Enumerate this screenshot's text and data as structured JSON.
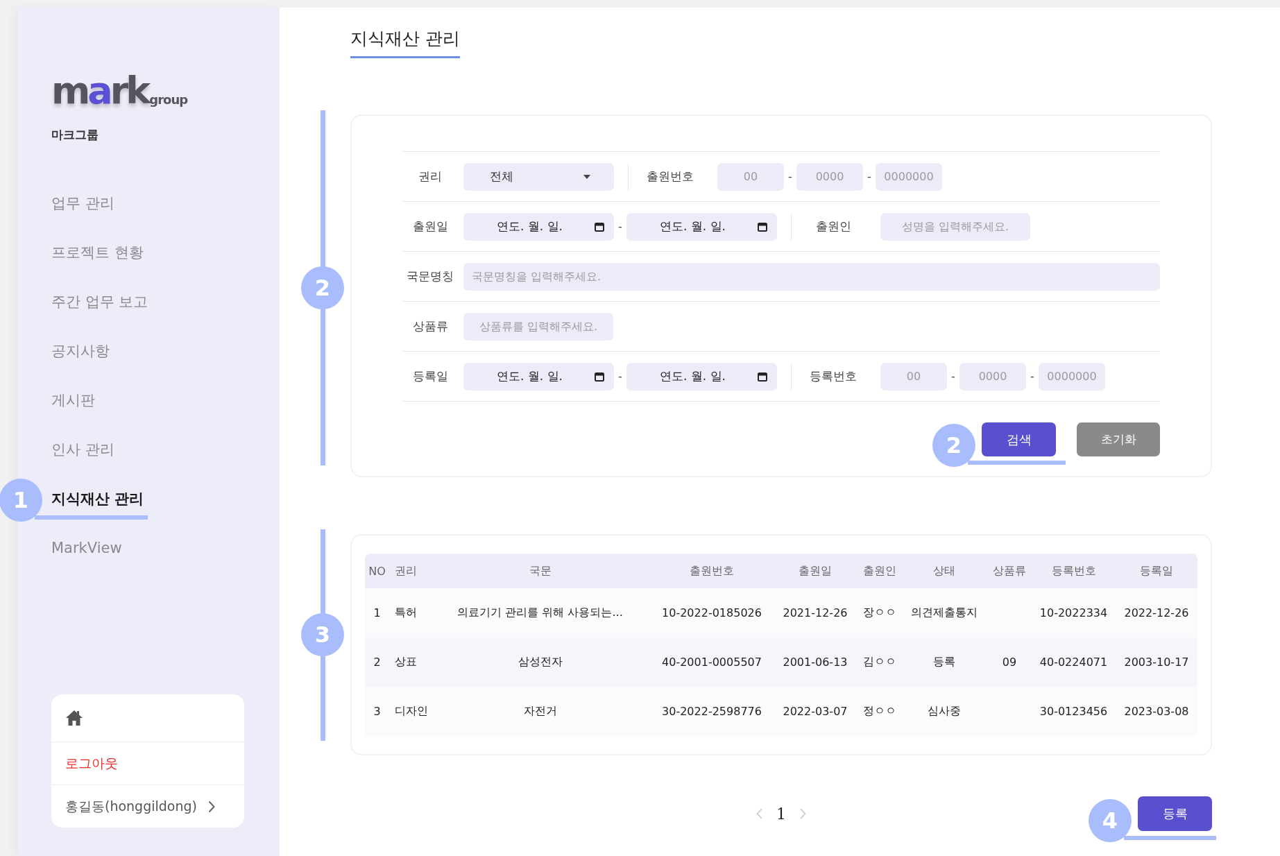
{
  "sidebar": {
    "logo": {
      "wordmark": "mark",
      "sub": "group"
    },
    "company": "마크그룹",
    "items": [
      {
        "label": "업무 관리",
        "selected": false
      },
      {
        "label": "프로젝트 현황",
        "selected": false
      },
      {
        "label": "주간 업무 보고",
        "selected": false
      },
      {
        "label": "공지사항",
        "selected": false
      },
      {
        "label": "게시판",
        "selected": false
      },
      {
        "label": "인사 관리",
        "selected": false
      },
      {
        "label": "지식재산 관리",
        "selected": true
      },
      {
        "label": "MarkView",
        "selected": false
      }
    ],
    "user_card": {
      "logout": "로그아웃",
      "user": "홍길동(honggildong)"
    }
  },
  "page_title": "지식재산 관리",
  "search_form": {
    "separator": "-",
    "rows": [
      {
        "fields": [
          {
            "kind": "select",
            "label": "권리",
            "value": "전체"
          },
          {
            "kind": "number",
            "label": "출원번호",
            "placeholders": [
              "00",
              "0000",
              "0000000"
            ]
          }
        ]
      },
      {
        "fields": [
          {
            "kind": "date_range",
            "label": "출원일",
            "parts": [
              "연도. 월. 일.",
              "연도. 월. 일."
            ]
          },
          {
            "kind": "text",
            "label": "출원인",
            "placeholder": "성명을 입력해주세요."
          }
        ]
      },
      {
        "fields": [
          {
            "kind": "wide_text",
            "label": "국문명칭",
            "placeholder": "국문명칭을 입력해주세요."
          }
        ]
      },
      {
        "fields": [
          {
            "kind": "text",
            "label": "상품류",
            "placeholder": "상품류를 입력해주세요."
          }
        ]
      },
      {
        "fields": [
          {
            "kind": "date_range",
            "label": "등록일",
            "parts": [
              "연도. 월. 일.",
              "연도. 월. 일."
            ]
          },
          {
            "kind": "number",
            "label": "등록번호",
            "placeholders": [
              "00",
              "0000",
              "0000000"
            ]
          }
        ]
      }
    ],
    "search_button": "검색",
    "reset_button": "초기화"
  },
  "table": {
    "columns": [
      "NO",
      "권리",
      "국문",
      "출원번호",
      "출원일",
      "출원인",
      "상태",
      "상품류",
      "등록번호",
      "등록일"
    ],
    "rows": [
      [
        "1",
        "특허",
        "의료기기 관리를 위해 사용되는...",
        "10-2022-0185026",
        "2021-12-26",
        "장ㅇㅇ",
        "의견제출통지",
        "",
        "10-2022334",
        "2022-12-26"
      ],
      [
        "2",
        "상표",
        "삼성전자",
        "40-2001-0005507",
        "2001-06-13",
        "김ㅇㅇ",
        "등록",
        "09",
        "40-0224071",
        "2003-10-17"
      ],
      [
        "3",
        "디자인",
        "자전거",
        "30-2022-2598776",
        "2022-03-07",
        "정ㅇㅇ",
        "심사중",
        "",
        "30-0123456",
        "2023-03-08"
      ]
    ]
  },
  "pagination": {
    "pages": [
      {
        "label": "1",
        "selected": true
      }
    ]
  },
  "register_button": "등록",
  "callouts": [
    {
      "number": "1",
      "kind": "underline"
    },
    {
      "number": "2",
      "kind": "side_bar"
    },
    {
      "number": "2",
      "kind": "underline"
    },
    {
      "number": "3",
      "kind": "side_bar"
    },
    {
      "number": "4",
      "kind": "underline"
    }
  ]
}
